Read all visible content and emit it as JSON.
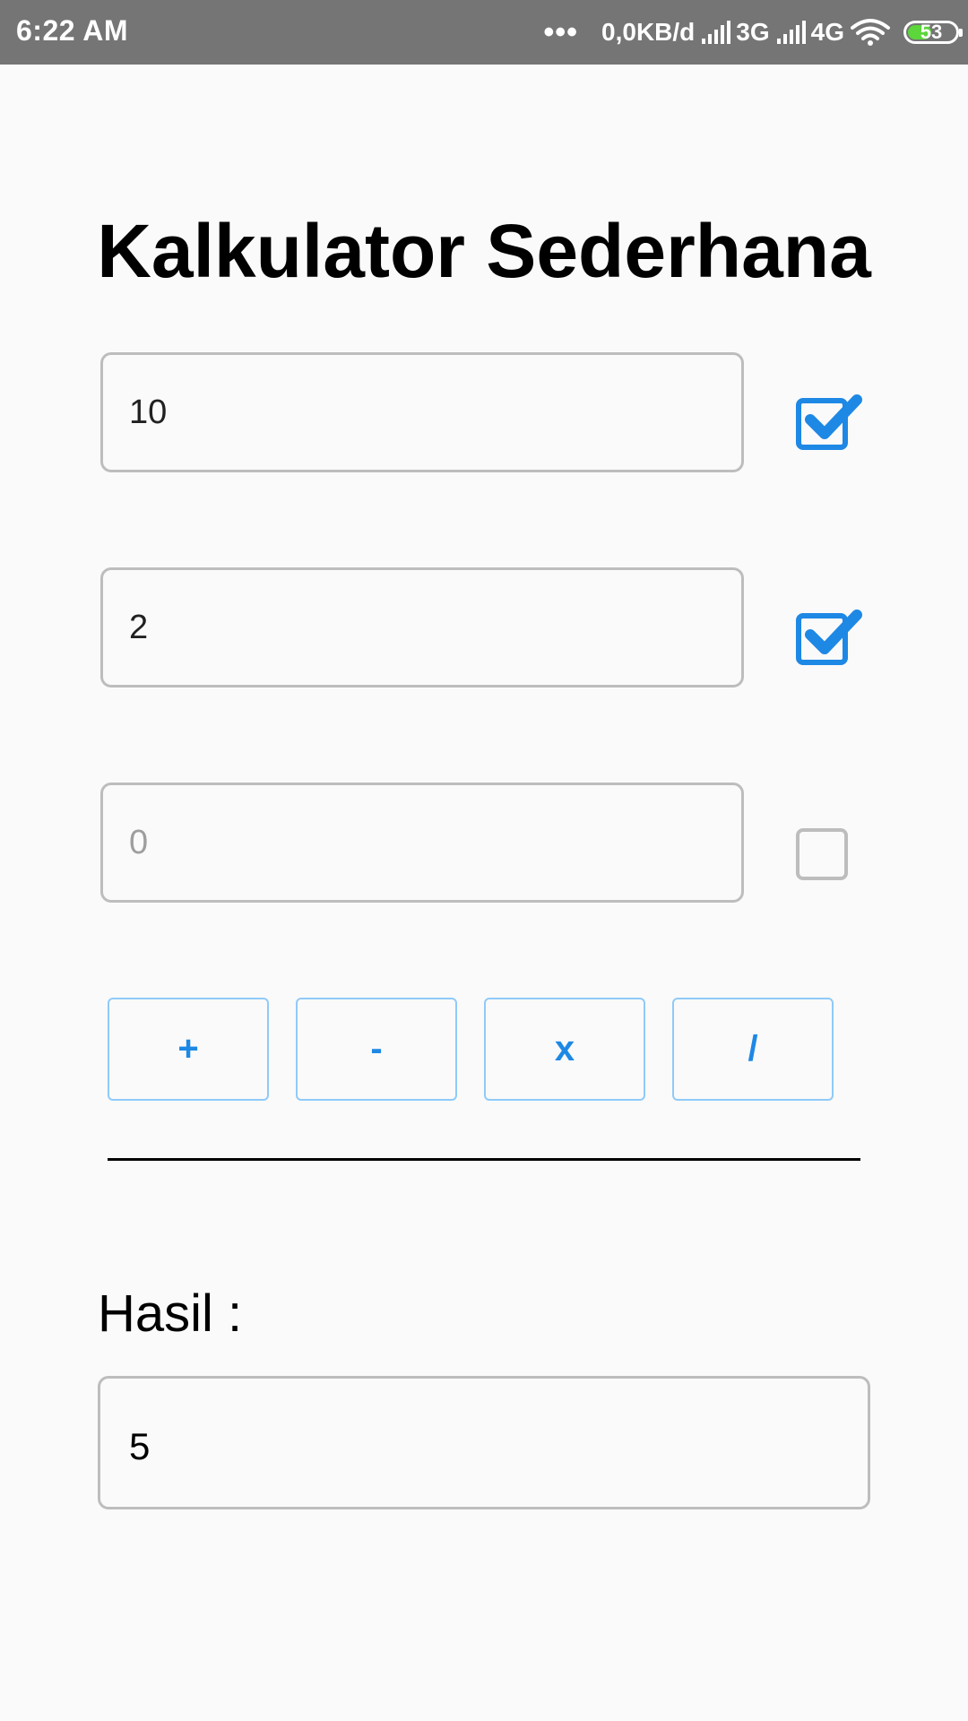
{
  "status_bar": {
    "time": "6:22 AM",
    "more": "•••",
    "data_rate": "0,0KB/d",
    "network1": "3G",
    "network2": "4G",
    "battery": "53",
    "battery_level_percent": 53,
    "battery_color": "#5cd63a"
  },
  "title": "Kalkulator Sederhana",
  "inputs": [
    {
      "value": "10",
      "placeholder": "0",
      "checked": true
    },
    {
      "value": "2",
      "placeholder": "0",
      "checked": true
    },
    {
      "value": "",
      "placeholder": "0",
      "checked": false
    }
  ],
  "operators": {
    "plus": "+",
    "minus": "-",
    "times": "x",
    "divide": "/"
  },
  "result": {
    "label": "Hasil :",
    "value": "5"
  },
  "colors": {
    "accent": "#1e88e5",
    "status_bar": "#757575",
    "border": "#bdbdbd"
  }
}
